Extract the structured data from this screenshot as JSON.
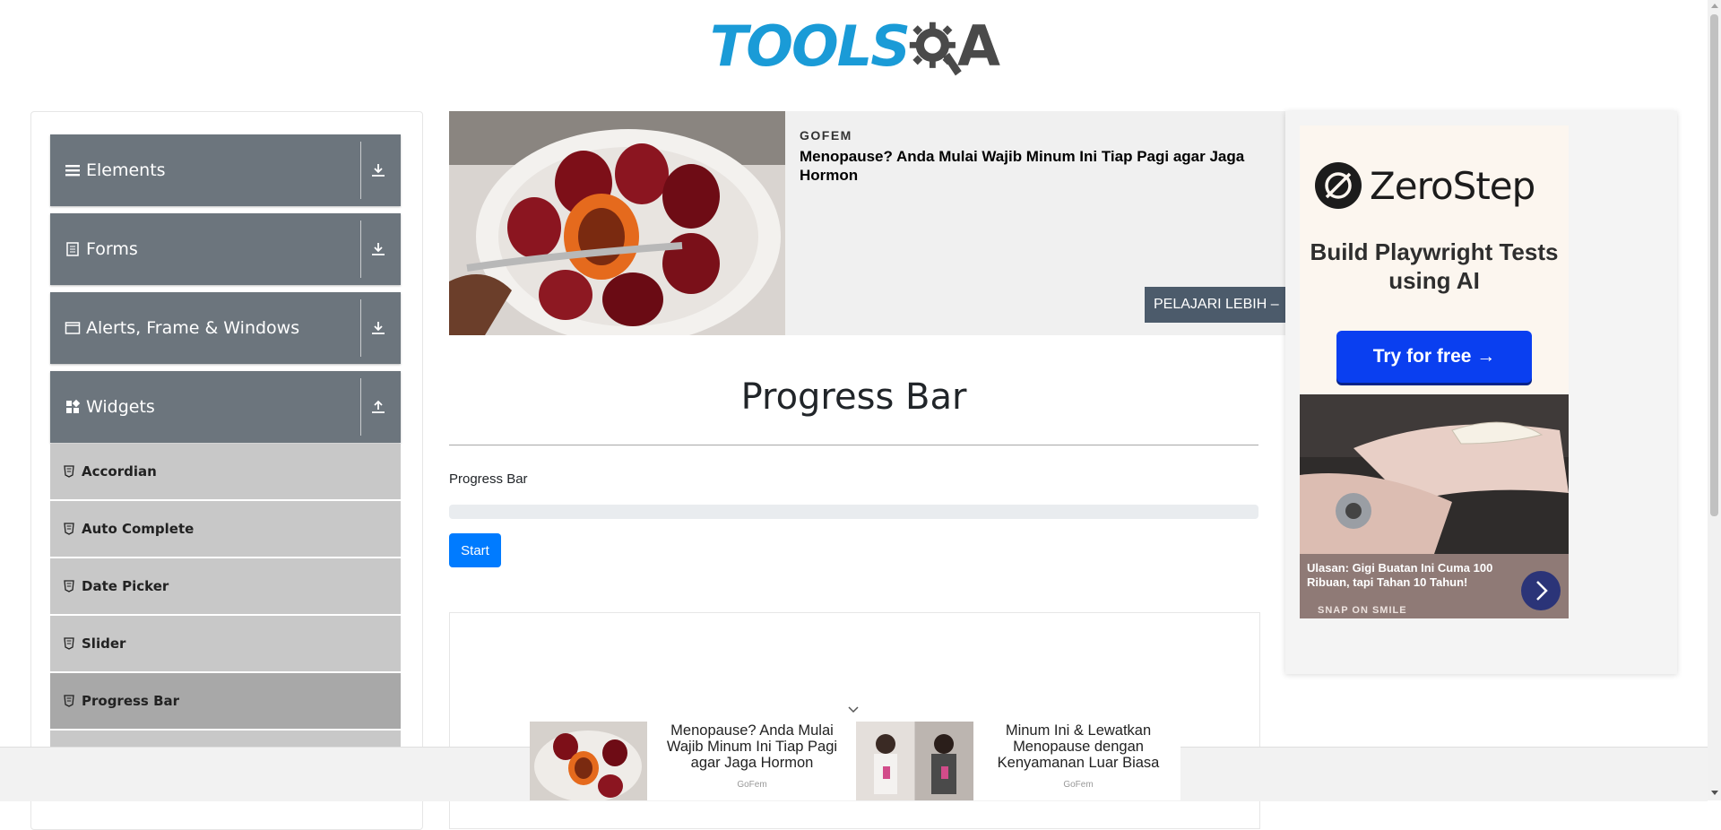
{
  "header": {
    "logo_text_left": "TOOLS",
    "logo_text_right": "A",
    "logo_alt": "TOOLSQA"
  },
  "sidebar": {
    "groups": [
      {
        "label": "Elements",
        "icon": "hamburger-icon",
        "toggle": "download-icon"
      },
      {
        "label": "Forms",
        "icon": "form-icon",
        "toggle": "download-icon"
      },
      {
        "label": "Alerts, Frame & Windows",
        "icon": "window-icon",
        "toggle": "download-icon"
      },
      {
        "label": "Widgets",
        "icon": "widgets-icon",
        "toggle": "upload-icon"
      }
    ],
    "widget_items": [
      "Accordian",
      "Auto Complete",
      "Date Picker",
      "Slider",
      "Progress Bar"
    ],
    "active_item": "Progress Bar"
  },
  "top_ad": {
    "brand": "GOFEM",
    "title": "Menopause? Anda Mulai Wajib Minum Ini Tiap Pagi agar Jaga Hormon",
    "button": "PELAJARI LEBIH –"
  },
  "main": {
    "title": "Progress Bar",
    "label": "Progress Bar",
    "progress_value": 0,
    "start_button": "Start"
  },
  "right_ad": {
    "zerostep_brand": "ZeroStep",
    "zerostep_tagline": "Build Playwright Tests using AI",
    "zerostep_button": "Try for free →",
    "snap_title": "Ulasan: Gigi Buatan Ini Cuma 100 Ribuan, tapi Tahan 10 Tahun!",
    "snap_brand": "SNAP ON SMILE"
  },
  "sticky_ads": [
    {
      "title": "Menopause? Anda Mulai Wajib Minum Ini Tiap Pagi agar Jaga Hormon",
      "brand": "GoFem"
    },
    {
      "title": "Minum Ini & Lewatkan Menopause dengan Kenyamanan Luar Biasa",
      "brand": "GoFem"
    }
  ],
  "colors": {
    "logo_blue": "#1a9bd7",
    "sidebar_group": "#6c757d",
    "primary": "#007bff",
    "cta_blue": "#0a3ff0"
  }
}
